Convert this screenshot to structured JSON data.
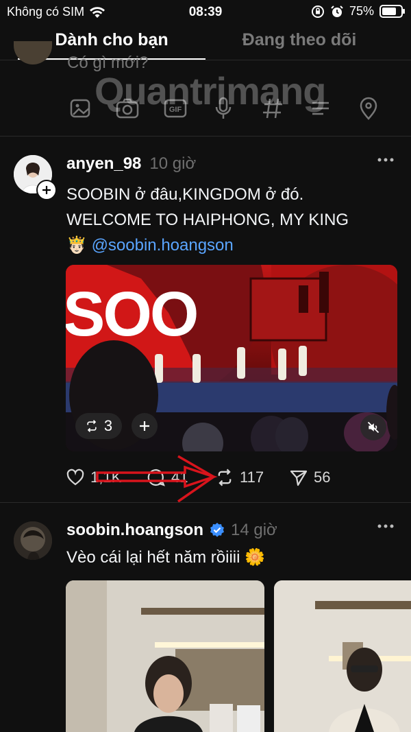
{
  "status_bar": {
    "carrier": "Không có SIM",
    "time": "08:39",
    "battery": "75%"
  },
  "tabs": {
    "for_you": "Dành cho bạn",
    "following": "Đang theo dõi"
  },
  "composer": {
    "placeholder": "Có gì mới?",
    "watermark": "Quantrimang"
  },
  "post1": {
    "username": "anyen_98",
    "time": "10 giờ",
    "line1": "SOOBIN ở đâu,KINGDOM ở đó.",
    "line2": "WELCOME TO  HAIPHONG, MY KING",
    "emoji": "🤴🏻",
    "mention": "@soobin.hoangson",
    "media_sign": "SOO",
    "repost_count": "3",
    "likes": "1,1K",
    "comments": "41",
    "reposts": "117",
    "shares": "56"
  },
  "post2": {
    "username": "soobin.hoangson",
    "time": "14 giờ",
    "text": "Vèo cái lại hết năm rồiiii",
    "emoji": "🌼"
  },
  "colors": {
    "background": "#101010",
    "mention": "#5aa5ff",
    "verified": "#3b8fff",
    "annotation_arrow": "#d8141c"
  }
}
